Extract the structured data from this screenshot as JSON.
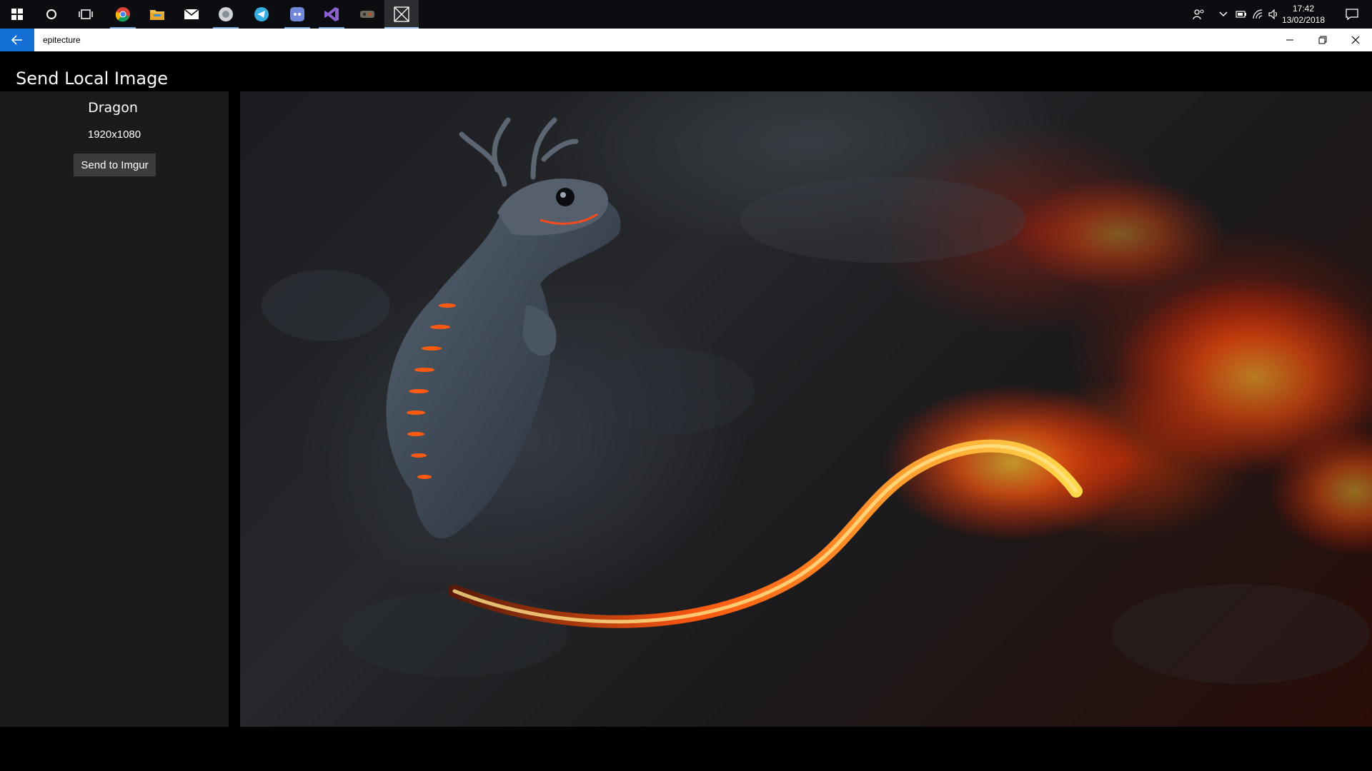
{
  "taskbar": {
    "apps": [
      {
        "name": "start"
      },
      {
        "name": "cortana"
      },
      {
        "name": "task-view"
      },
      {
        "name": "chrome"
      },
      {
        "name": "file-explorer"
      },
      {
        "name": "mail"
      },
      {
        "name": "app-unknown"
      },
      {
        "name": "telegram"
      },
      {
        "name": "discord"
      },
      {
        "name": "visual-studio"
      },
      {
        "name": "app-game"
      },
      {
        "name": "epitecture"
      }
    ],
    "clock": {
      "time": "17:42",
      "date": "13/02/2018"
    }
  },
  "window": {
    "title": "epitecture"
  },
  "page": {
    "title": "Send Local Image"
  },
  "image": {
    "name": "Dragon",
    "dimensions": "1920x1080"
  },
  "actions": {
    "send_label": "Send to Imgur"
  },
  "colors": {
    "accent": "#1570d6",
    "panel": "#1b1b1b",
    "button": "#3c3c3c"
  }
}
